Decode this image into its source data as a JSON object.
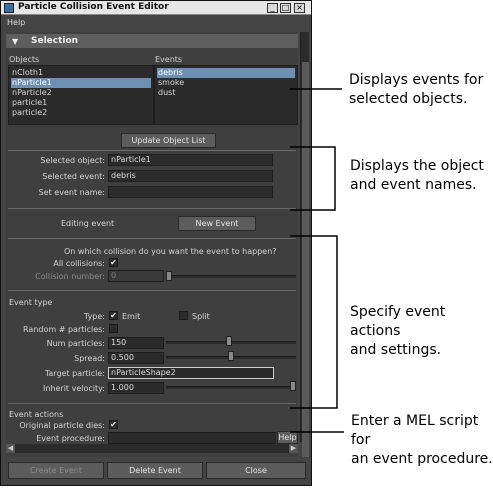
{
  "window": {
    "title": "Particle Collision Event Editor",
    "menu": "Help"
  },
  "selection": {
    "header": "Selection",
    "objects_header": "Objects",
    "events_header": "Events",
    "objects": [
      "nCloth1",
      "nParticle1",
      "nParticle2",
      "particle1",
      "particle2"
    ],
    "objects_selected": "nParticle1",
    "events": [
      "debris",
      "smoke",
      "dust"
    ],
    "events_selected": "debris",
    "update_button": "Update Object List",
    "selected_object_label": "Selected object:",
    "selected_object_value": "nParticle1",
    "selected_event_label": "Selected event:",
    "selected_event_value": "debris",
    "set_event_name_label": "Set event name:",
    "set_event_name_value": ""
  },
  "editing": {
    "label": "Editing event",
    "new_event_button": "New Event"
  },
  "collision": {
    "question": "On which collision do you want the event to happen?",
    "all_collisions_label": "All collisions:",
    "all_collisions_checked": "✔",
    "collision_number_label": "Collision number:",
    "collision_number_value": "0"
  },
  "event_type": {
    "header": "Event type",
    "type_label": "Type:",
    "emit_label": "Emit",
    "emit_checked": "✔",
    "split_label": "Split",
    "random_label": "Random # particles:",
    "num_particles_label": "Num particles:",
    "num_particles_value": "150",
    "num_particles_fraction": 0.48,
    "spread_label": "Spread:",
    "spread_value": "0.500",
    "spread_fraction": 0.5,
    "target_particle_label": "Target particle:",
    "target_particle_value": "nParticleShape2",
    "inherit_velocity_label": "Inherit velocity:",
    "inherit_velocity_value": "1.000",
    "inherit_velocity_fraction": 1.0
  },
  "event_actions": {
    "header": "Event actions",
    "original_dies_label": "Original particle dies:",
    "original_dies_checked": "✔",
    "event_procedure_label": "Event procedure:",
    "event_procedure_value": "",
    "help_button": "Help"
  },
  "footer": {
    "create_button": "Create Event",
    "delete_button": "Delete Event",
    "close_button": "Close"
  },
  "callouts": {
    "c1": [
      "Displays events for",
      "selected objects."
    ],
    "c2": [
      "Displays the object",
      "and event names."
    ],
    "c3": [
      "Specify event actions",
      "and settings."
    ],
    "c4": [
      "Enter a MEL script for",
      "an event procedure."
    ]
  }
}
